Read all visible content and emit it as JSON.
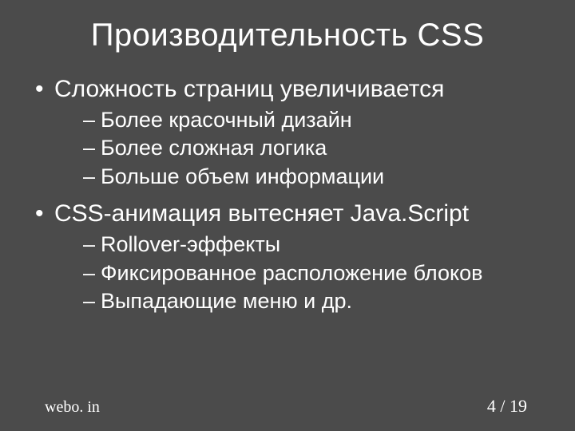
{
  "title": "Производительность CSS",
  "bullets": [
    {
      "text": "Сложность страниц увеличивается",
      "children": [
        "Более красочный дизайн",
        "Более сложная логика",
        "Больше объем информации"
      ]
    },
    {
      "text": "CSS-анимация вытесняет Java.Script",
      "children": [
        "Rollover-эффекты",
        "Фиксированное расположение блоков",
        "Выпадающие меню и др."
      ]
    }
  ],
  "footer": {
    "site": "webo. in",
    "page_current": "4",
    "sep": " / ",
    "page_total": "19"
  }
}
